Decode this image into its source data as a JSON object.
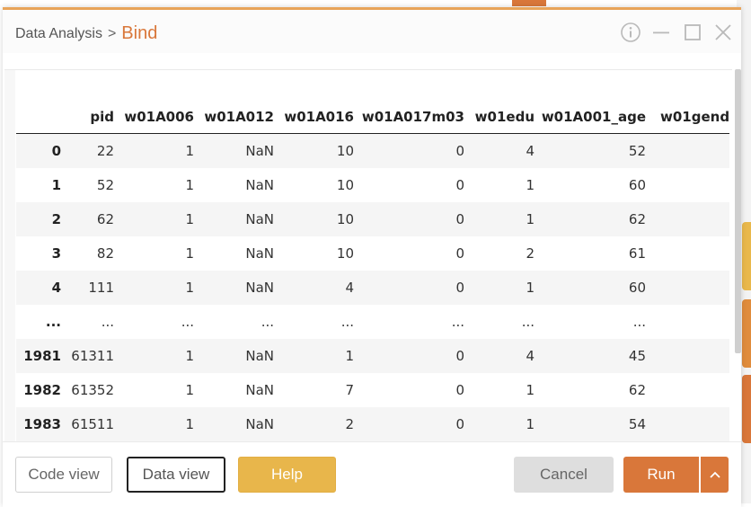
{
  "dialog": {
    "breadcrumb_parent": "Data Analysis",
    "breadcrumb_sep": ">",
    "breadcrumb_current": "Bind"
  },
  "icons": [
    "info-icon",
    "minimize-icon",
    "maximize-icon",
    "close-icon",
    "chevron-up-icon"
  ],
  "table": {
    "columns": [
      "pid",
      "w01A006",
      "w01A012",
      "w01A016",
      "w01A017m03",
      "w01edu",
      "w01A001_age",
      "w01gend"
    ],
    "rows": [
      {
        "index": "0",
        "cells": [
          "22",
          "1",
          "NaN",
          "10",
          "0",
          "4",
          "52",
          ""
        ]
      },
      {
        "index": "1",
        "cells": [
          "52",
          "1",
          "NaN",
          "10",
          "0",
          "1",
          "60",
          ""
        ]
      },
      {
        "index": "2",
        "cells": [
          "62",
          "1",
          "NaN",
          "10",
          "0",
          "1",
          "62",
          ""
        ]
      },
      {
        "index": "3",
        "cells": [
          "82",
          "1",
          "NaN",
          "10",
          "0",
          "2",
          "61",
          ""
        ]
      },
      {
        "index": "4",
        "cells": [
          "111",
          "1",
          "NaN",
          "4",
          "0",
          "1",
          "60",
          ""
        ]
      },
      {
        "index": "...",
        "cells": [
          "...",
          "...",
          "...",
          "...",
          "...",
          "...",
          "...",
          ""
        ]
      },
      {
        "index": "1981",
        "cells": [
          "61311",
          "1",
          "NaN",
          "1",
          "0",
          "4",
          "45",
          ""
        ]
      },
      {
        "index": "1982",
        "cells": [
          "61352",
          "1",
          "NaN",
          "7",
          "0",
          "1",
          "62",
          ""
        ]
      },
      {
        "index": "1983",
        "cells": [
          "61511",
          "1",
          "NaN",
          "2",
          "0",
          "1",
          "54",
          ""
        ]
      }
    ]
  },
  "footer": {
    "code_view": "Code view",
    "data_view": "Data view",
    "help": "Help",
    "cancel": "Cancel",
    "run": "Run"
  },
  "colors": {
    "accent": "#d9773a",
    "help": "#e8b64b",
    "cancel_bg": "#dedede"
  }
}
